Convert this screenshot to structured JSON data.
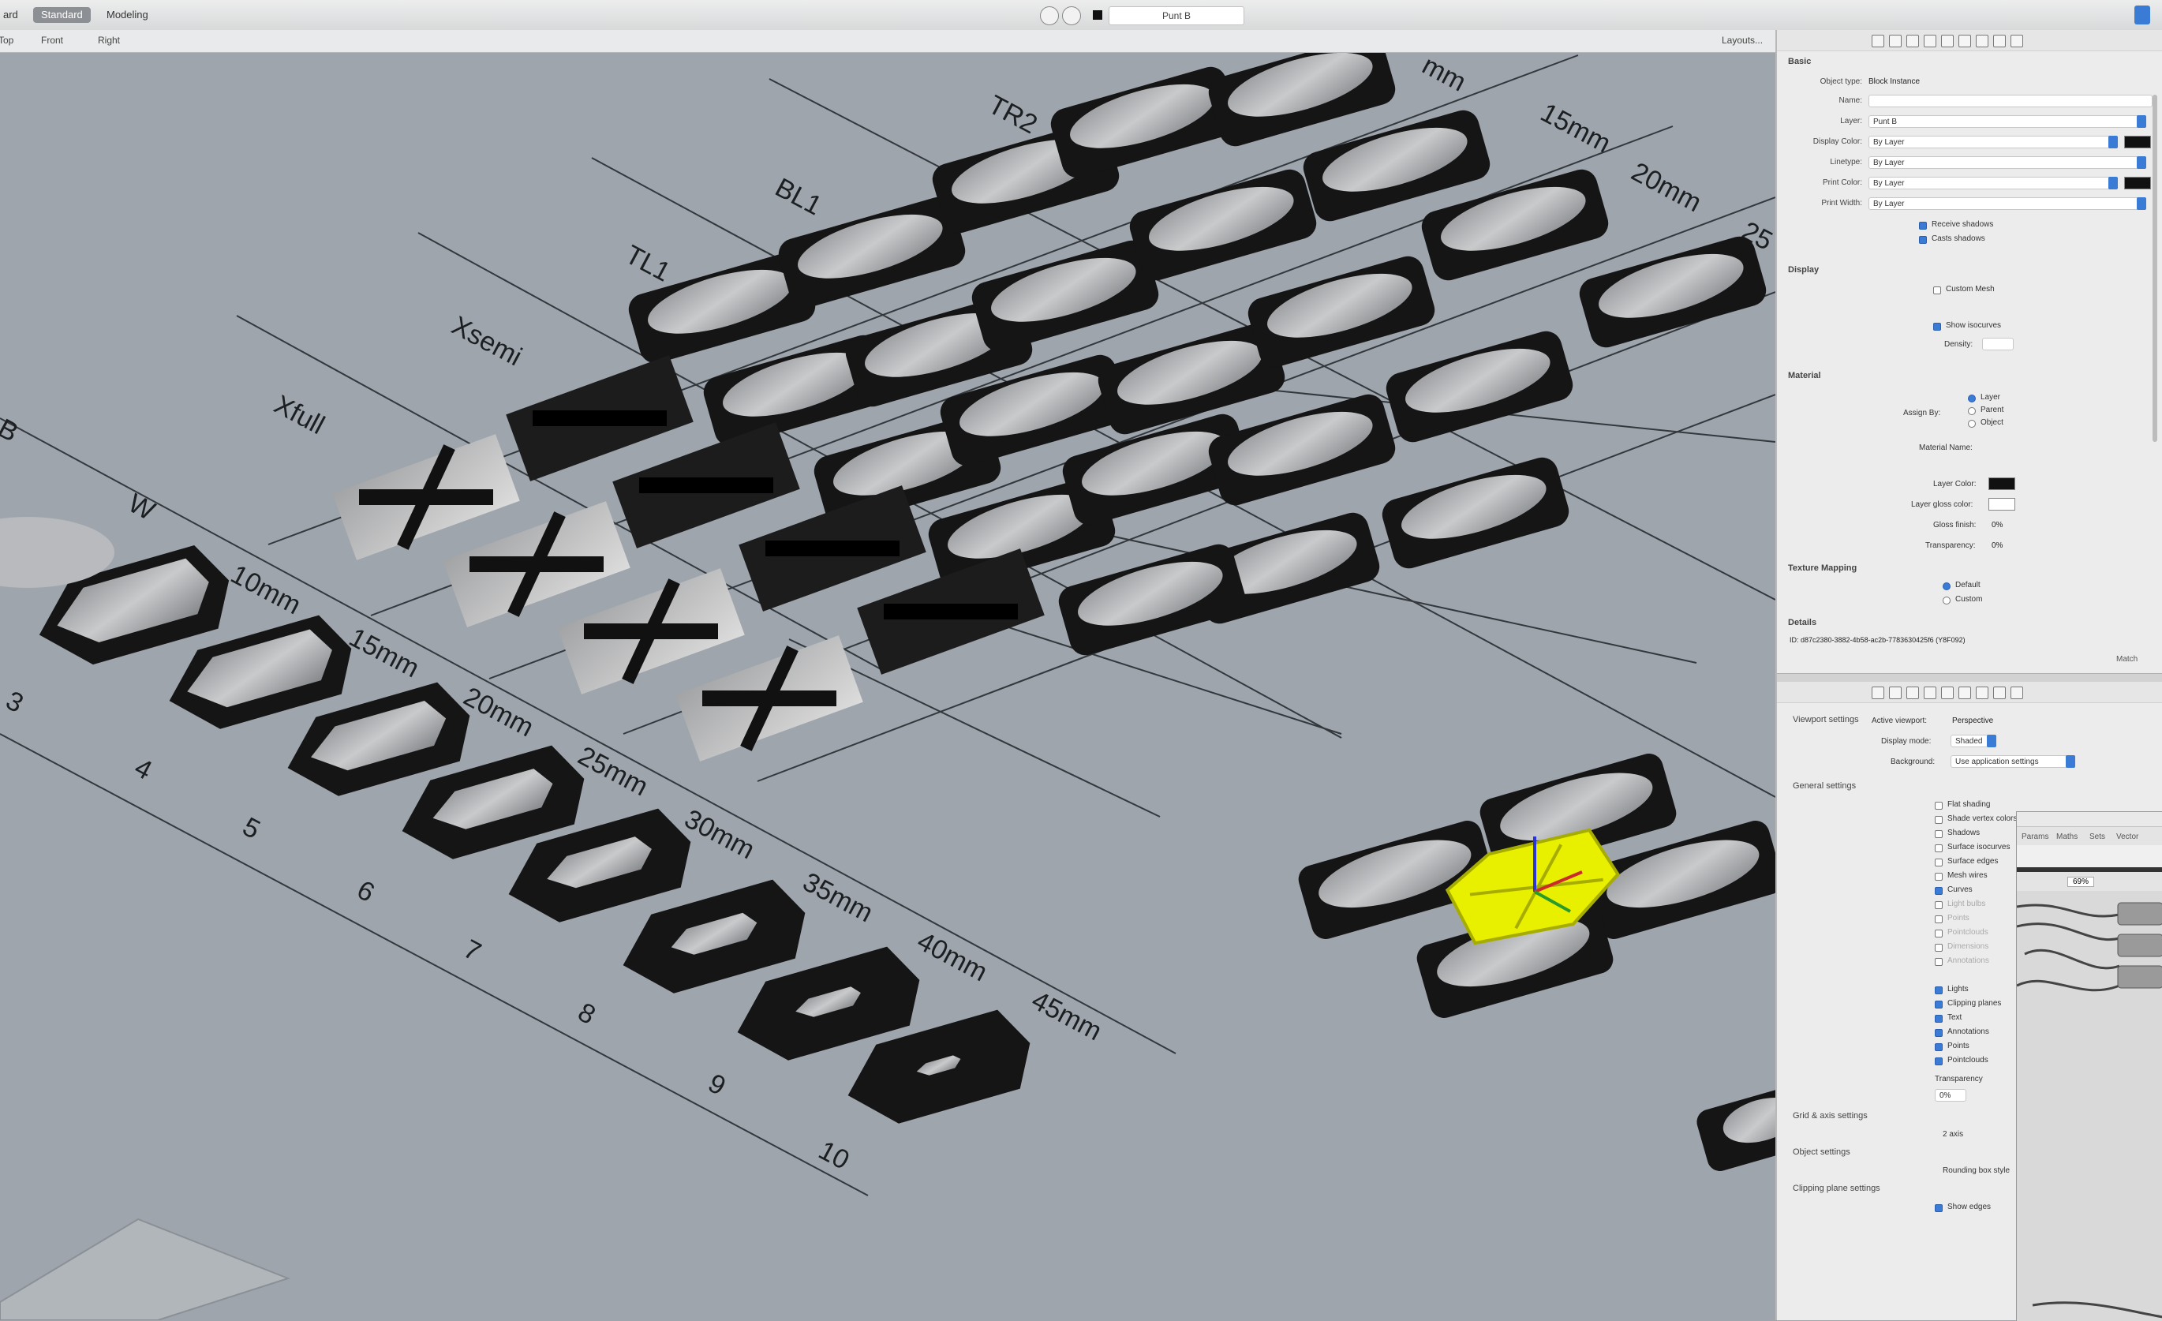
{
  "topbar": {
    "tabs": [
      "ard",
      "Standard",
      "Modeling"
    ],
    "current_layer": "Punt B"
  },
  "viewport_tabs": [
    "Top",
    "Front",
    "Right"
  ],
  "layout_button": "Layouts...",
  "viewport": {
    "row_labels": [
      "TR2",
      "BL1",
      "TL1",
      "Xsemi",
      "Xfull",
      "W",
      "B"
    ],
    "size_labels": [
      "10mm",
      "15mm",
      "20mm",
      "25mm",
      "30mm",
      "35mm",
      "40mm",
      "45mm"
    ],
    "index_labels": [
      "3",
      "4",
      "5",
      "6",
      "7",
      "8",
      "9",
      "10"
    ],
    "top_row_labels": [
      "mm",
      "15mm",
      "20mm",
      "25"
    ]
  },
  "properties": {
    "base_section": "Basic",
    "object_type_label": "Object type:",
    "object_type": "Block Instance",
    "name_label": "Name:",
    "name_value": "",
    "layer_label": "Layer:",
    "layer_value": "Punt B",
    "display_color_label": "Display Color:",
    "display_color_value": "By Layer",
    "linetype_label": "Linetype:",
    "linetype_value": "By Layer",
    "print_color_label": "Print Color:",
    "print_color_value": "By Layer",
    "print_width_label": "Print Width:",
    "print_width_value": "By Layer",
    "receive_shadows": "Receive shadows",
    "casts_shadows": "Casts shadows",
    "display_section": "Display",
    "custom_mesh": "Custom Mesh",
    "show_isocurves": "Show isocurves",
    "density_label": "Density:",
    "material_section": "Material",
    "assign_by_label": "Assign By:",
    "assign_options": [
      "Layer",
      "Parent",
      "Object"
    ],
    "material_name_label": "Material Name:",
    "layer_color_label": "Layer Color:",
    "layer_gloss_label": "Layer gloss color:",
    "gloss_finish_label": "Gloss finish:",
    "gloss_finish_value": "0%",
    "transparency_label": "Transparency:",
    "transparency_value": "0%",
    "texture_section": "Texture Mapping",
    "texture_options": [
      "Default",
      "Custom"
    ],
    "details_section": "Details",
    "details_value": "ID: d87c2380-3882-4b58-ac2b-7783630425f6 (Y8F092)",
    "match_button": "Match"
  },
  "viewport_settings": {
    "title": "Viewport settings",
    "active_viewport_label": "Active viewport:",
    "active_viewport_value": "Perspective",
    "display_mode_label": "Display mode:",
    "display_mode_value": "Shaded",
    "background_label": "Background:",
    "background_value": "Use application settings",
    "general_title": "General settings",
    "general_options": [
      "Flat shading",
      "Shade vertex colors",
      "Shadows",
      "Surface isocurves",
      "Surface edges",
      "Mesh wires",
      "Curves",
      "Light bulbs",
      "Points",
      "Pointclouds",
      "Dimensions",
      "Annotations"
    ],
    "more_options": [
      "Lights",
      "Clipping planes",
      "Text",
      "Annotations",
      "Points",
      "Pointclouds"
    ],
    "transparency_label": "Transparency",
    "transparency_value": "0%",
    "grid_title": "Grid & axis settings",
    "grid_value": "2 axis",
    "object_title": "Object settings",
    "object_value": "Rounding box style",
    "clipping_title": "Clipping plane settings",
    "show_edges": "Show edges"
  },
  "grasshopper": {
    "tabs": [
      "Params",
      "Maths",
      "Sets",
      "Vector"
    ],
    "zoom": "69%"
  },
  "colors": {
    "viewport_bg": "#9ea5ad",
    "selection": "#e8f000",
    "accent": "#3a7bd5"
  }
}
